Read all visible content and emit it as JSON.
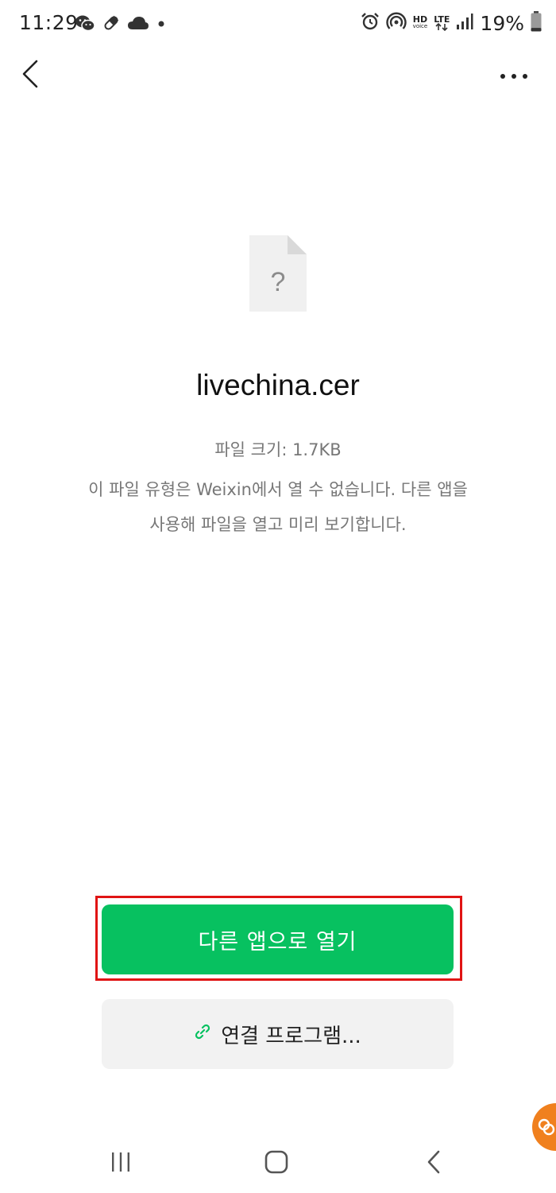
{
  "status_bar": {
    "time": "11:29",
    "left_icons": [
      "wechat-icon",
      "pill-icon",
      "cloud-icon",
      "dot-icon"
    ],
    "right_icons": [
      "alarm-icon",
      "hotspot-icon",
      "hd-voice-icon",
      "lte-icon",
      "signal-icon",
      "battery-icon"
    ],
    "hd_label": "HD",
    "voice_label": "voice",
    "lte_label": "LTE",
    "battery_percent": "19%",
    "battery_level": 0.19
  },
  "app_bar": {
    "back_icon": "chevron-left-icon",
    "more_icon": "more-horizontal-icon"
  },
  "file": {
    "icon": "unknown-file-icon",
    "name": "livechina.cer",
    "size_label": "파일 크기: 1.7KB",
    "message": "이 파일 유형은 Weixin에서 열 수 없습니다. 다른 앱을 사용해 파일을 열고 미리 보기합니다."
  },
  "actions": {
    "open_other_label": "다른 앱으로 열기",
    "open_with_label": "연결 프로그램...",
    "open_with_icon": "link-icon"
  },
  "colors": {
    "primary_green": "#07c160",
    "secondary_bg": "#f2f2f2",
    "highlight_red": "#e01414",
    "muted_text": "#777777"
  },
  "nav_bar": {
    "icons": [
      "recent-apps-icon",
      "home-icon",
      "back-icon"
    ]
  }
}
